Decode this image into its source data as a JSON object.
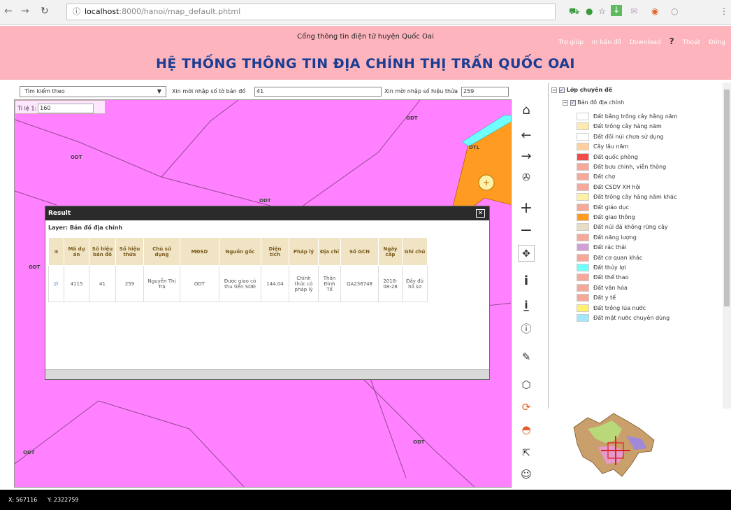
{
  "browser": {
    "url_host": "localhost",
    "url_path": ":8000/hanoi/map_default.phtml"
  },
  "header": {
    "portal_name": "Cổng thông tin điện tử huyện Quốc Oai",
    "title": "HỆ THỐNG THÔNG TIN ĐỊA CHÍNH THỊ TRẤN QUỐC OAI",
    "links": [
      "Trợ giúp",
      "In bản đồ",
      "Download",
      "?",
      "Thoát",
      "Đóng"
    ]
  },
  "toolbar": {
    "search_select": "Tìm kiếm theo",
    "map_sheet_label": "Xin mời nhập số tờ bản đồ",
    "map_sheet_value": "41",
    "parcel_label": "Xin mời nhập số hiệu thửa",
    "parcel_value": "259"
  },
  "map": {
    "scale_label": "Tỉ lệ 1:",
    "scale_value": "160",
    "land_code": "ODT",
    "other_code": "DTL"
  },
  "result": {
    "title": "Result",
    "layer_label": "Layer: Bản đồ địa chính",
    "columns": [
      "Mã dự án",
      "Số hiệu bản đồ",
      "Số hiệu thửa",
      "Chủ sử dụng",
      "MĐSD",
      "Nguồn gốc",
      "Diện tích",
      "Pháp lý",
      "Địa chỉ",
      "Số GCN",
      "Ngày cấp",
      "Ghi chú"
    ],
    "rows": [
      [
        "4115",
        "41",
        "259",
        "Nguyễn Thị Trà",
        "ODT",
        "Được giao có thu tiền SDĐ",
        "144.04",
        "Chính thức có pháp lý",
        "Thôn Đình Tổ",
        "QA236748",
        "2018-08-28",
        "Đầy đủ hồ sơ"
      ]
    ]
  },
  "legend": {
    "root": "Lớp chuyên đề",
    "group": "Bản đồ địa chính",
    "items": [
      {
        "label": "Đất bằng trồng cây hằng năm",
        "color": "#ffffff"
      },
      {
        "label": "Đất trồng cây hàng năm",
        "color": "#ffe9b0"
      },
      {
        "label": "Đất đồi núi chưa sử dụng",
        "color": "#ffffff"
      },
      {
        "label": "Cây lâu năm",
        "color": "#ffd09e"
      },
      {
        "label": "Đất quốc phòng",
        "color": "#f04a4a"
      },
      {
        "label": "Đất bưu chính, viễn thông",
        "color": "#f6a89a"
      },
      {
        "label": "Đất chợ",
        "color": "#f6a89a"
      },
      {
        "label": "Đất CSDV XH hội",
        "color": "#f6a89a"
      },
      {
        "label": "Đất trồng cây hàng năm khác",
        "color": "#fff0a8"
      },
      {
        "label": "Đất giáo dục",
        "color": "#f6a89a"
      },
      {
        "label": "Đất giao thông",
        "color": "#ff9b20"
      },
      {
        "label": "Đất núi đá không rừng cây",
        "color": "#e8dcc4"
      },
      {
        "label": "Đất năng lượng",
        "color": "#f6a89a"
      },
      {
        "label": "Đất rác thải",
        "color": "#d0a0d8"
      },
      {
        "label": "Đất cơ quan khác",
        "color": "#f6a89a"
      },
      {
        "label": "Đất thủy lợi",
        "color": "#70ffff"
      },
      {
        "label": "Đất thể thao",
        "color": "#f6a89a"
      },
      {
        "label": "Đất văn hóa",
        "color": "#f6a89a"
      },
      {
        "label": "Đất y tế",
        "color": "#f6a89a"
      },
      {
        "label": "Đất trồng lúa nước",
        "color": "#fff070"
      },
      {
        "label": "Đất mặt nước chuyên dùng",
        "color": "#a0e8ff"
      }
    ]
  },
  "status": {
    "x": "X: 567116",
    "y": "Y: 2322759"
  }
}
